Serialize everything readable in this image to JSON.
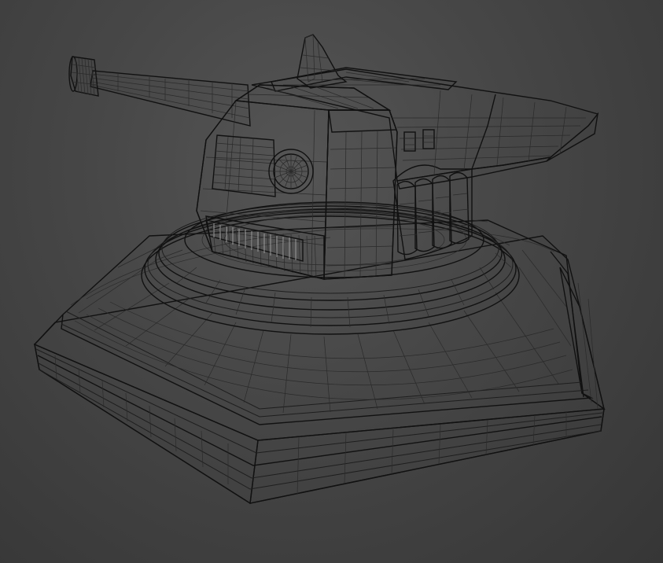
{
  "viewport": {
    "view": "perspective",
    "shading": "default-shading-with-edged-faces",
    "background_color": "#3c3c3c",
    "surface_color": "#bdbdbd",
    "wire_color": "#1e1e1e"
  },
  "model": {
    "kind": "turret-wireframe",
    "parts": [
      "hexagonal-base",
      "round-platform",
      "turret-housing",
      "gun-barrel",
      "rear-fins",
      "round-hatch",
      "vent-grille",
      "recoil-rings"
    ]
  }
}
